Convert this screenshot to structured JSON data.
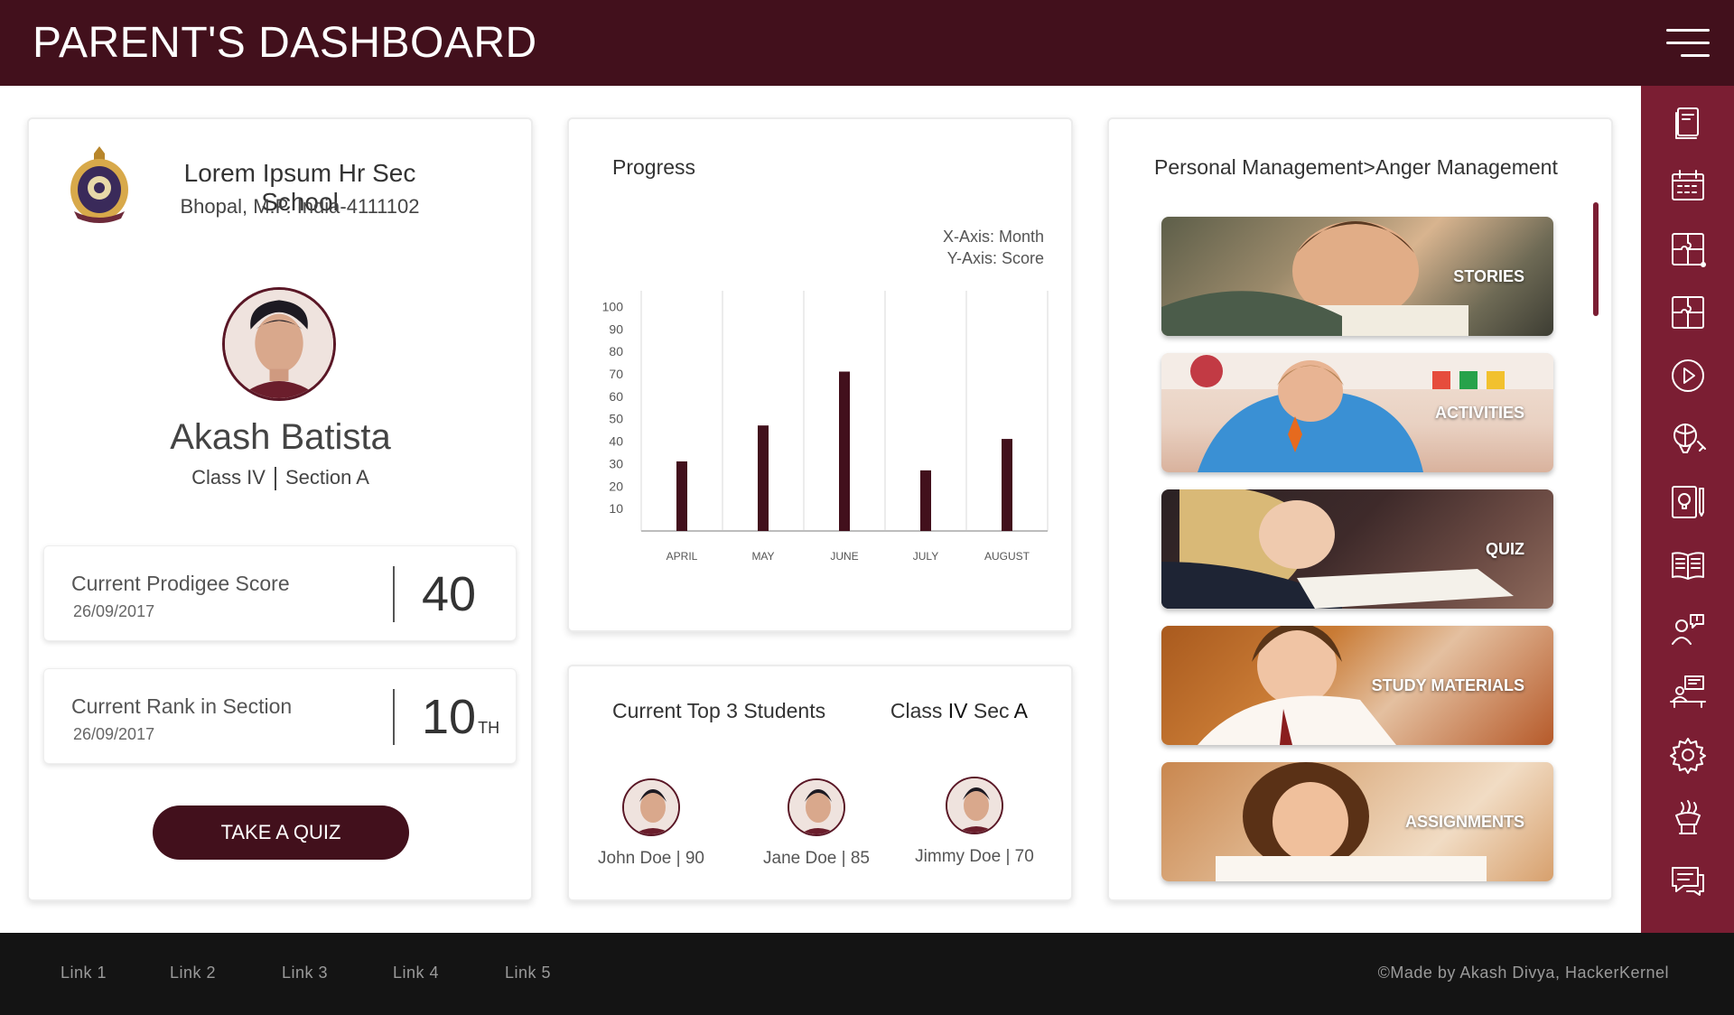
{
  "header": {
    "title": "PARENT'S DASHBOARD"
  },
  "profile": {
    "school_name": "Lorem Ipsum Hr Sec School",
    "school_address": "Bhopal, M.P. India-4111102",
    "student_name": "Akash Batista",
    "class": "Class IV",
    "section": "Section A",
    "score": {
      "label": "Current Prodigee Score",
      "date": "26/09/2017",
      "value": "40"
    },
    "rank": {
      "label": "Current Rank in Section",
      "date": "26/09/2017",
      "value": "10",
      "suffix": "TH"
    },
    "quiz_button": "TAKE A QUIZ"
  },
  "progress": {
    "title": "Progress",
    "x_axis_note": "X-Axis: Month",
    "y_axis_note": "Y-Axis: Score"
  },
  "chart_data": {
    "type": "bar",
    "categories": [
      "APRIL",
      "MAY",
      "JUNE",
      "JULY",
      "AUGUST"
    ],
    "values": [
      31,
      47,
      71,
      27,
      41
    ],
    "yticks": [
      10,
      20,
      30,
      40,
      50,
      60,
      70,
      80,
      90,
      100
    ],
    "ylim": [
      0,
      107
    ],
    "color": "#42101c",
    "grid": "vertical"
  },
  "top_students": {
    "title": "Current Top 3 Students",
    "class_prefix": "Class",
    "class_value": "IV",
    "sec_prefix": "Sec",
    "sec_value": "A",
    "students": [
      {
        "label": "John Doe | 90"
      },
      {
        "label": "Jane Doe | 85"
      },
      {
        "label": "Jimmy Doe | 70"
      }
    ]
  },
  "activities": {
    "title": "Personal Management>Anger Management",
    "tiles": [
      {
        "label": "STORIES"
      },
      {
        "label": "ACTIVITIES"
      },
      {
        "label": "QUIZ"
      },
      {
        "label": "STUDY MATERIALS"
      },
      {
        "label": "ASSIGNMENTS"
      }
    ]
  },
  "sidebar_icons": [
    "notebook-icon",
    "calendar-icon",
    "puzzle-icon",
    "puzzle-alt-icon",
    "play-icon",
    "balloon-icon",
    "lightbulb-book-icon",
    "open-book-icon",
    "teacher-icon",
    "classroom-icon",
    "gear-icon",
    "handshake-icon",
    "chat-icon"
  ],
  "footer": {
    "links": [
      "Link 1",
      "Link 2",
      "Link 3",
      "Link 4",
      "Link 5"
    ],
    "credit": "©Made by Akash Divya, HackerKernel"
  },
  "colors": {
    "primary": "#42101c",
    "sidebar": "#7b1e33",
    "footer": "#141414"
  }
}
